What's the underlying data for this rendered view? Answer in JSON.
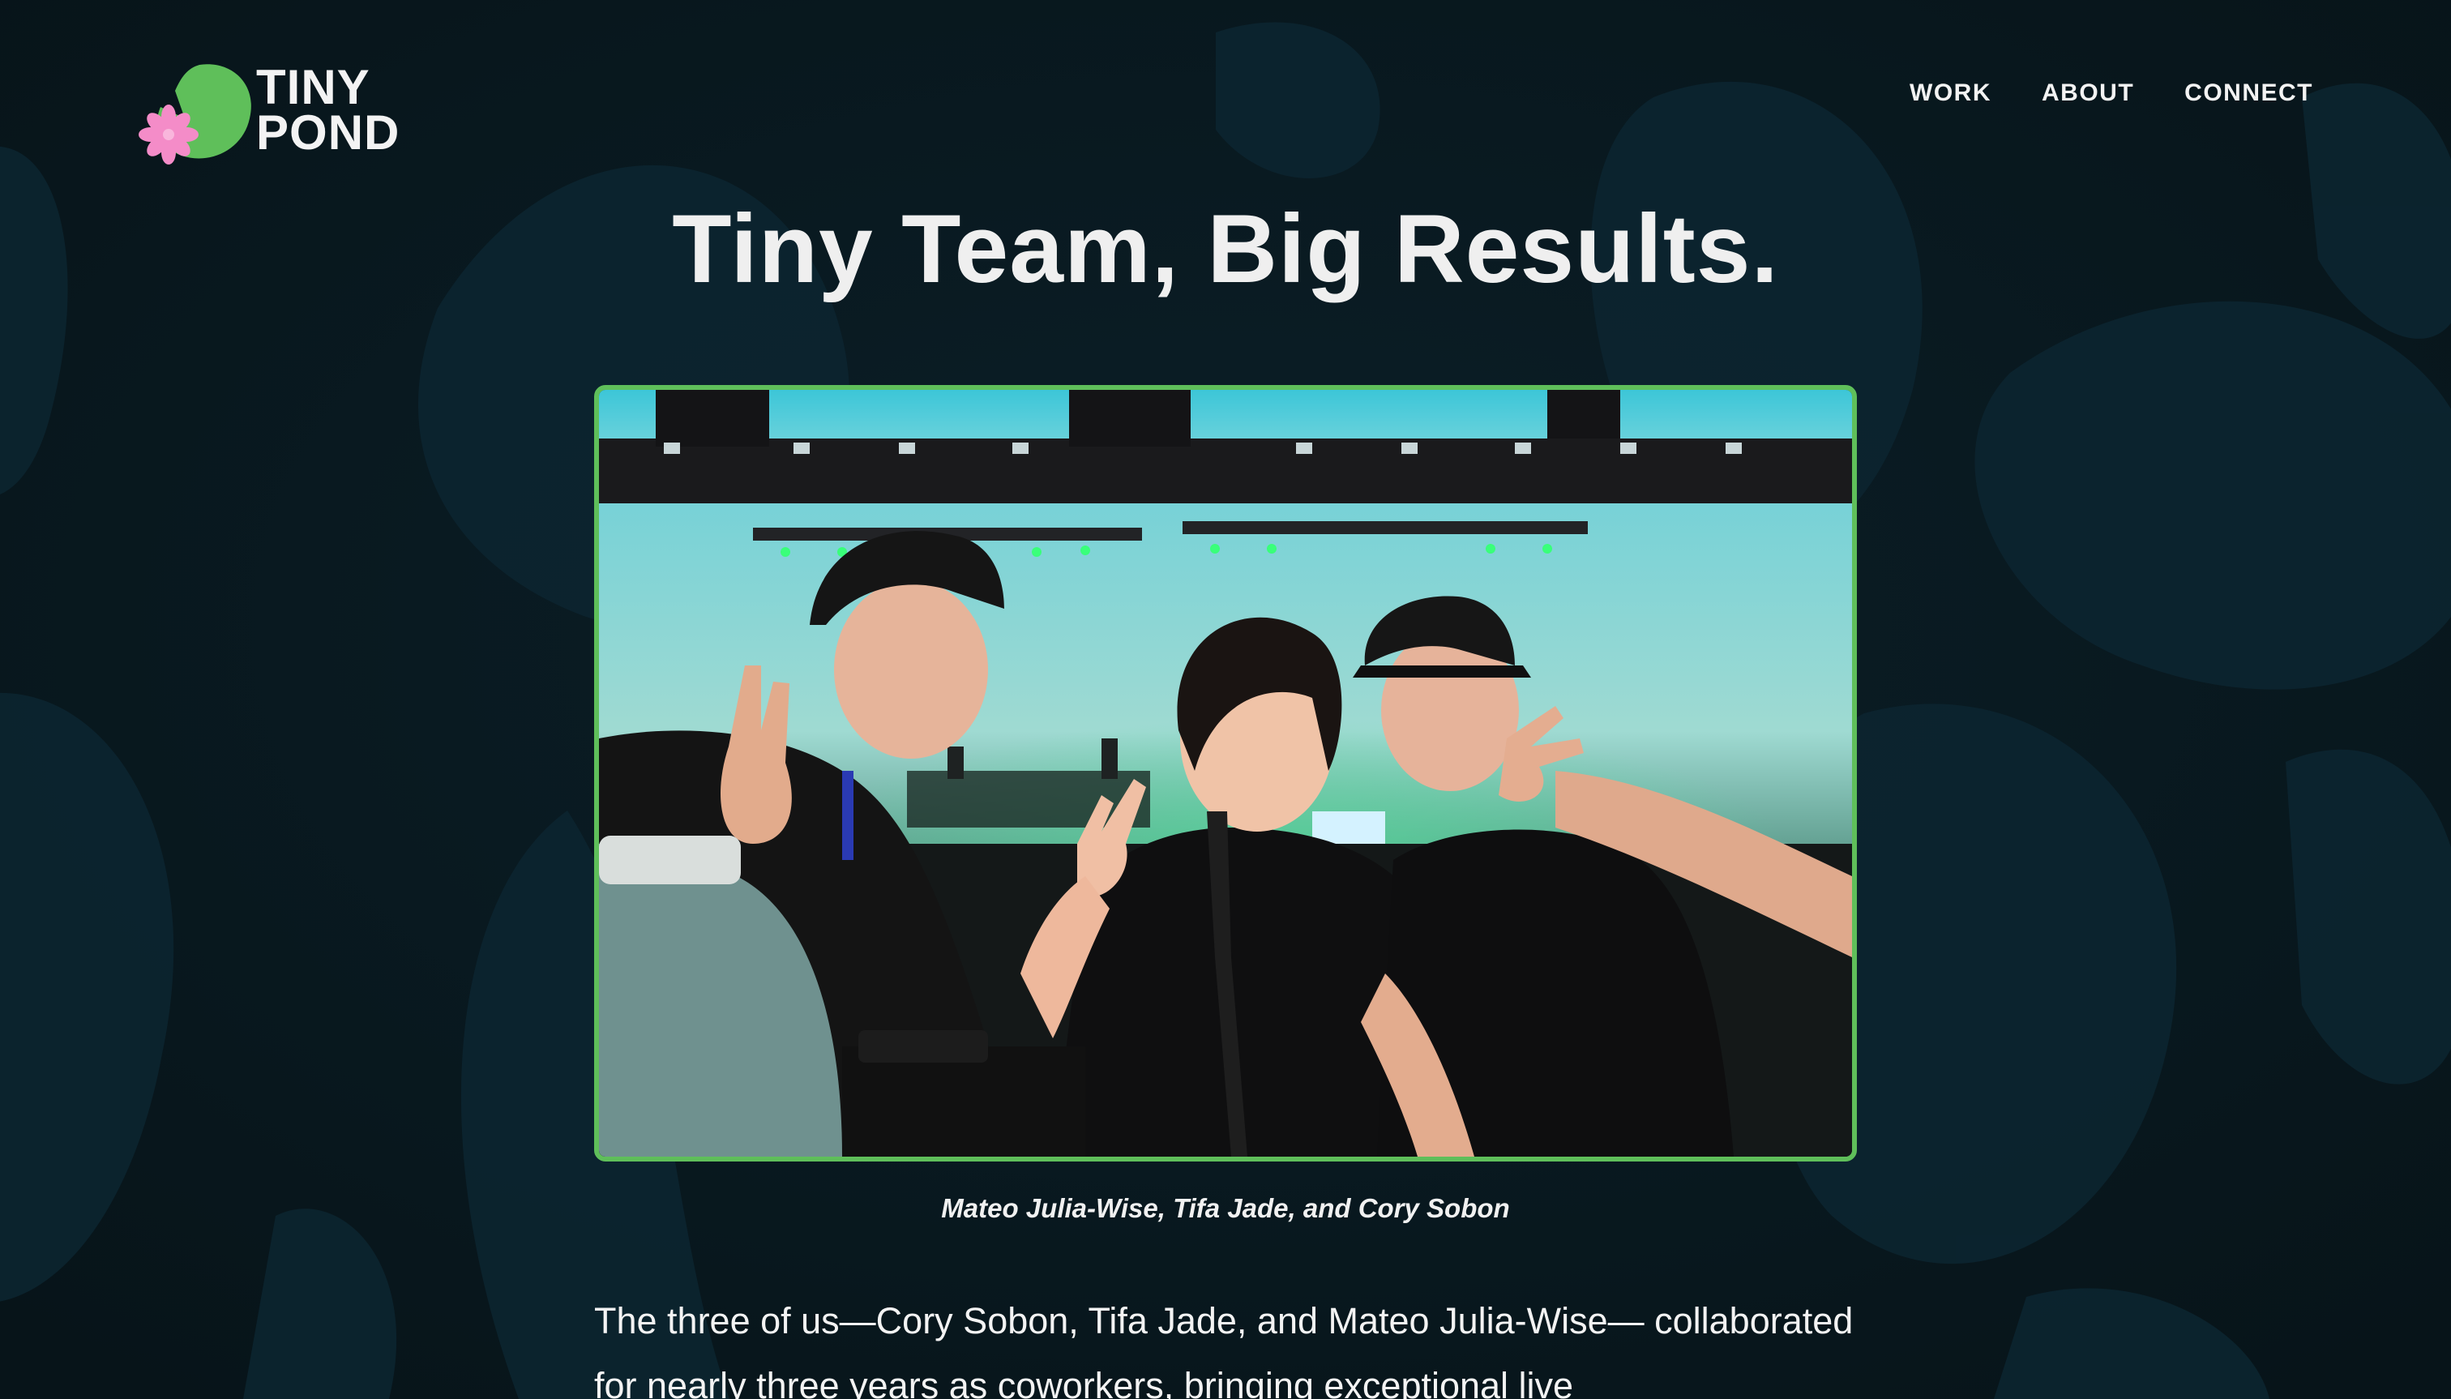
{
  "brand": {
    "line1": "TINY",
    "line2": "POND"
  },
  "nav": {
    "items": [
      {
        "label": "WORK"
      },
      {
        "label": "ABOUT"
      },
      {
        "label": "CONNECT"
      }
    ]
  },
  "hero": {
    "title": "Tiny Team, Big Results."
  },
  "photo": {
    "caption": "Mateo Julia-Wise, Tifa Jade, and Cory Sobon"
  },
  "intro": {
    "paragraph": "The three of us—Cory Sobon, Tifa Jade, and Mateo Julia-Wise— collaborated for nearly three years as coworkers, bringing exceptional live"
  },
  "colors": {
    "background": "#0a1d25",
    "accent_green": "#5fbf5a",
    "lotus_pink": "#f48cc8",
    "text": "#f3f3f3"
  }
}
